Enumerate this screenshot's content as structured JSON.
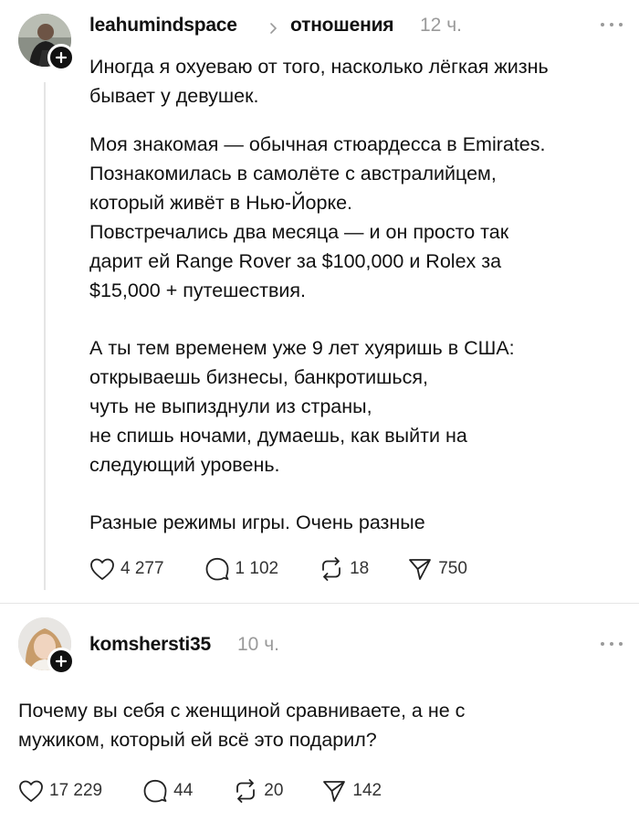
{
  "post": {
    "username": "leahumindspace",
    "topic": "отношения",
    "time": "12 ч.",
    "paragraphs": [
      "Иногда я охуеваю от того, насколько лёгкая жизнь\nбывает у девушек.",
      "Моя знакомая — обычная стюардесса в Emirates.\nПознакомилась в самолёте с австралийцем,\nкоторый живёт в Нью-Йорке.\nПовстречались два месяца — и он просто так\nдарит ей Range Rover за $100,000 и Rolex за\n$15,000 + путешествия.",
      "А ты тем временем уже 9 лет хуяришь в США:\nоткрываешь бизнесы, банкротишься,\nчуть не выпизднули из страны,\nне спишь ночами, думаешь, как выйти на\nследующий уровень.",
      "Разные режимы игры. Очень разные"
    ],
    "stats": {
      "likes": "4 277",
      "comments": "1 102",
      "reposts": "18",
      "shares": "750"
    }
  },
  "reply": {
    "username": "komsherst i35",
    "time": "10 ч.",
    "text": "Почему вы себя с женщиной сравниваете, а не с\nмужиком, который ей всё это подарил?",
    "stats": {
      "likes": "17 229",
      "comments": "44",
      "reposts": "20",
      "shares": "142"
    }
  },
  "icons": {
    "like": "heart-icon",
    "comment": "comment-icon",
    "repost": "repost-icon",
    "share": "share-icon",
    "more": "more-icon",
    "follow": "plus-icon",
    "topic_separator": "chevron-right-icon"
  }
}
